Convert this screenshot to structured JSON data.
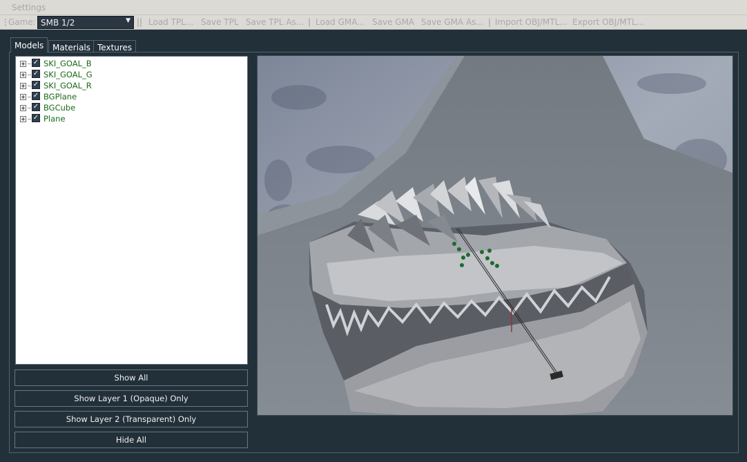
{
  "menubar": {
    "settings": "Settings"
  },
  "toolbar": {
    "game_label": "Game:",
    "game_value": "SMB 1/2",
    "separator": "||",
    "load_tpl": "Load TPL...",
    "save_tpl": "Save TPL",
    "save_tpl_as": "Save TPL As...",
    "sep2": "|",
    "load_gma": "Load GMA...",
    "save_gma": "Save GMA",
    "save_gma_as": "Save GMA As...",
    "sep3": "|",
    "import_obj": "Import OBJ/MTL...",
    "export_obj": "Export OBJ/MTL..."
  },
  "tabs": {
    "models": "Models",
    "materials": "Materials",
    "textures": "Textures"
  },
  "models": [
    {
      "name": "SKI_GOAL_B",
      "checked": true
    },
    {
      "name": "SKI_GOAL_G",
      "checked": true
    },
    {
      "name": "SKI_GOAL_R",
      "checked": true
    },
    {
      "name": "BGPlane",
      "checked": true
    },
    {
      "name": "BGCube",
      "checked": true
    },
    {
      "name": "Plane",
      "checked": true
    }
  ],
  "buttons": {
    "show_all": "Show All",
    "show_layer1": "Show Layer 1 (Opaque) Only",
    "show_layer2": "Show Layer 2 (Transparent) Only",
    "hide_all": "Hide All"
  },
  "colors": {
    "background": "#22303a",
    "model_name": "#1a6b1a",
    "toolbar": "#dcdad5"
  }
}
